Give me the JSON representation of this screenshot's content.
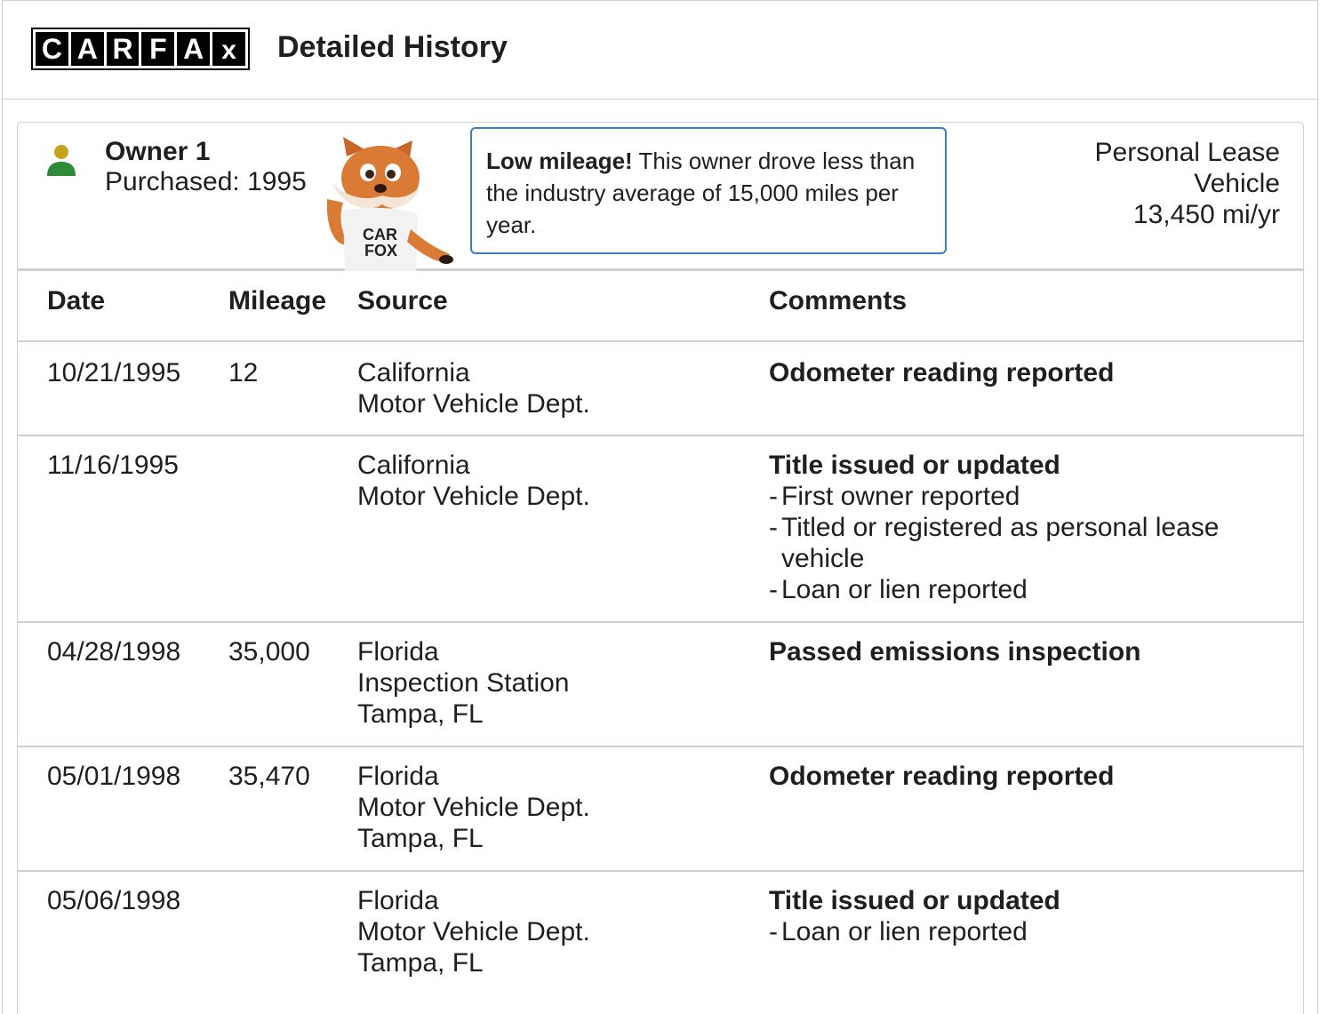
{
  "header": {
    "logo_letters": [
      "C",
      "A",
      "R",
      "F",
      "A",
      "x"
    ],
    "title": "Detailed History"
  },
  "owner": {
    "name": "Owner 1",
    "purchased": "Purchased: 1995",
    "callout_bold": "Low mileage!",
    "callout_text": " This owner drove less than the industry average of 15,000 miles per year.",
    "lease_line1": "Personal Lease",
    "lease_line2": "Vehicle",
    "mileage_rate": "13,450 mi/yr",
    "fox_shirt": [
      "CAR",
      "FOX"
    ]
  },
  "columns": {
    "date": "Date",
    "mileage": "Mileage",
    "source": "Source",
    "comments": "Comments"
  },
  "rows": [
    {
      "date": "10/21/1995",
      "mileage": "12",
      "source": [
        "California",
        "Motor Vehicle Dept."
      ],
      "comment_head": "Odometer reading reported",
      "bullets": []
    },
    {
      "date": "11/16/1995",
      "mileage": "",
      "source": [
        "California",
        "Motor Vehicle Dept."
      ],
      "comment_head": "Title issued or updated",
      "bullets": [
        "First owner reported",
        "Titled or registered as personal lease vehicle",
        "Loan or lien reported"
      ]
    },
    {
      "date": "04/28/1998",
      "mileage": "35,000",
      "source": [
        "Florida",
        "Inspection Station",
        "Tampa, FL"
      ],
      "comment_head": "Passed emissions inspection",
      "bullets": []
    },
    {
      "date": "05/01/1998",
      "mileage": "35,470",
      "source": [
        "Florida",
        "Motor Vehicle Dept.",
        "Tampa, FL"
      ],
      "comment_head": "Odometer reading reported",
      "bullets": []
    },
    {
      "date": "05/06/1998",
      "mileage": "",
      "source": [
        "Florida",
        "Motor Vehicle Dept.",
        "Tampa, FL"
      ],
      "comment_head": "Title issued or updated",
      "bullets": [
        "Loan or lien reported"
      ]
    }
  ]
}
